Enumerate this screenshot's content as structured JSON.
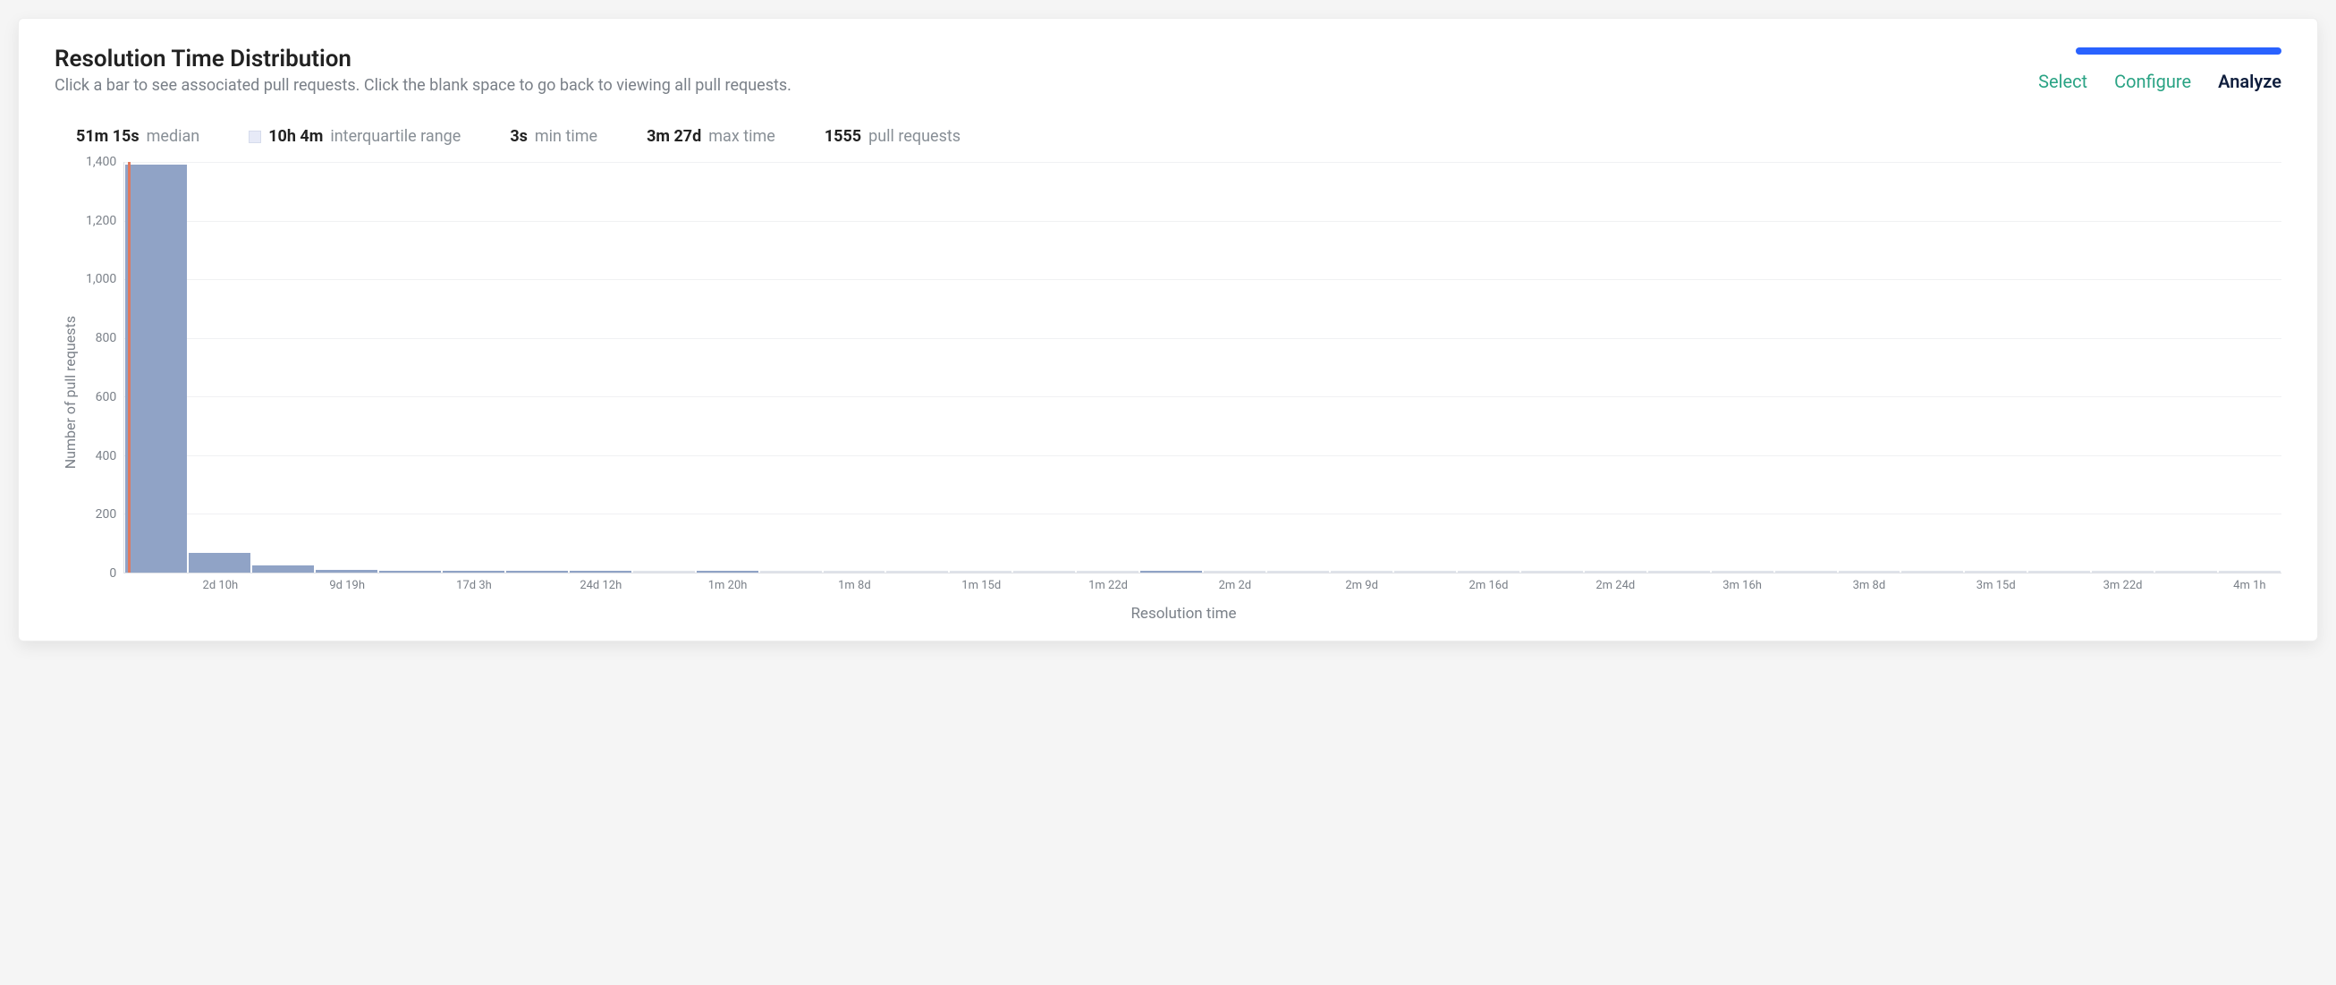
{
  "header": {
    "title": "Resolution Time Distribution",
    "subtitle": "Click a bar to see associated pull requests. Click the blank space to go back to viewing all pull requests."
  },
  "tabs": {
    "select": "Select",
    "configure": "Configure",
    "analyze": "Analyze"
  },
  "stats": {
    "median_value": "51m 15s",
    "median_label": "median",
    "iqr_value": "10h 4m",
    "iqr_label": "interquartile range",
    "min_value": "3s",
    "min_label": "min time",
    "max_value": "3m 27d",
    "max_label": "max time",
    "count_value": "1555",
    "count_label": "pull requests"
  },
  "chart_data": {
    "type": "bar",
    "title": "Resolution Time Distribution",
    "xlabel": "Resolution time",
    "ylabel": "Number of pull requests",
    "ylim": [
      0,
      1450
    ],
    "y_ticks": [
      0,
      200,
      400,
      600,
      800,
      1000,
      1200,
      1400
    ],
    "median_label": "51m 15s",
    "categories": [
      "",
      "2d 10h",
      "",
      "9d 19h",
      "",
      "17d 3h",
      "",
      "24d 12h",
      "",
      "1m 20h",
      "",
      "1m 8d",
      "",
      "1m 15d",
      "",
      "1m 22d",
      "",
      "2m 2d",
      "",
      "2m 9d",
      "",
      "2m 16d",
      "",
      "2m 24d",
      "",
      "3m 16h",
      "",
      "3m 8d",
      "",
      "3m 15d",
      "",
      "3m 22d",
      "",
      "4m 1h"
    ],
    "values": [
      1440,
      70,
      24,
      10,
      2,
      4,
      1,
      2,
      0,
      1,
      0,
      0,
      0,
      0,
      0,
      0,
      1,
      0,
      0,
      0,
      0,
      0,
      0,
      0,
      0,
      0,
      0,
      0,
      0,
      0,
      0,
      0,
      0,
      0
    ],
    "colors": {
      "bar": "#90a3c6",
      "median_line": "#e07a5f",
      "iqr_box": "#e7eaf7",
      "accent": "#2962ff"
    }
  }
}
